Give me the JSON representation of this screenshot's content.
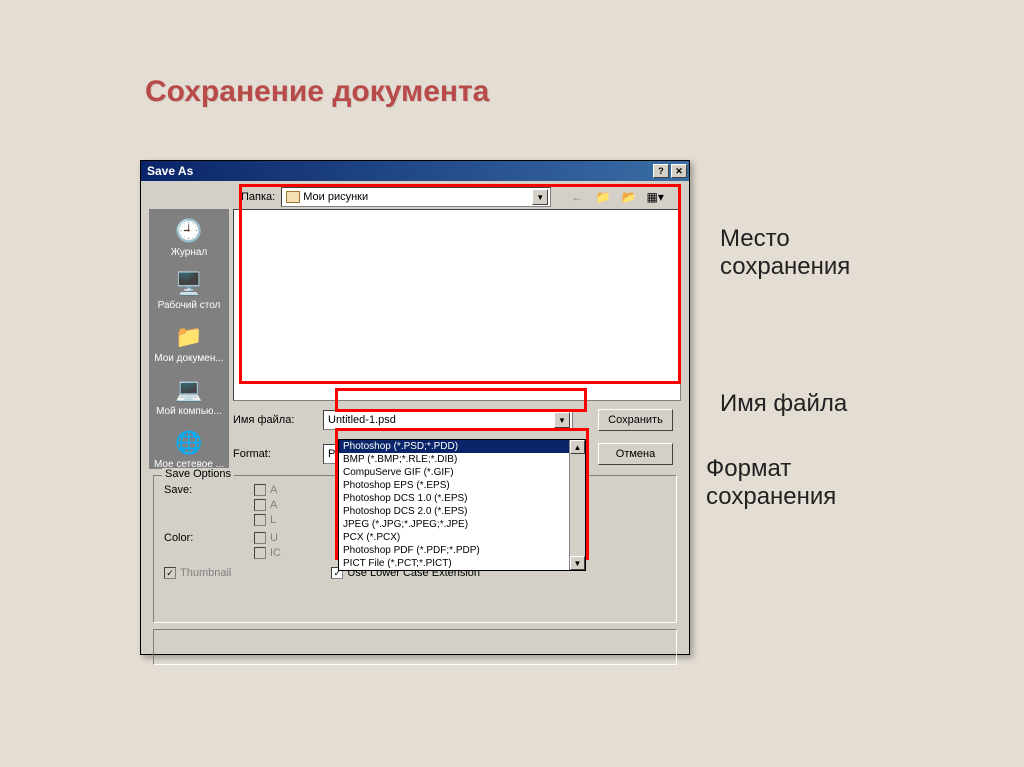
{
  "slide": {
    "title": "Сохранение документа"
  },
  "dialog": {
    "title": "Save As",
    "folder_label": "Папка:",
    "folder_value": "Мои рисунки",
    "places": [
      {
        "label": "Журнал"
      },
      {
        "label": "Рабочий стол"
      },
      {
        "label": "Мои докумен..."
      },
      {
        "label": "Мой компью..."
      },
      {
        "label": "Мое сетевое ..."
      }
    ],
    "name_label": "Имя файла:",
    "name_value": "Untitled-1.psd",
    "format_label": "Format:",
    "format_value": "Photoshop (*.PSD;*.PDD)",
    "format_options": [
      "Photoshop (*.PSD;*.PDD)",
      "BMP (*.BMP;*.RLE;*.DIB)",
      "CompuServe GIF (*.GIF)",
      "Photoshop EPS (*.EPS)",
      "Photoshop DCS 1.0 (*.EPS)",
      "Photoshop DCS 2.0 (*.EPS)",
      "JPEG (*.JPG;*.JPEG;*.JPE)",
      "PCX (*.PCX)",
      "Photoshop PDF (*.PDF;*.PDP)",
      "PICT File (*.PCT;*.PICT)"
    ],
    "save_btn": "Сохранить",
    "cancel_btn": "Отмена",
    "save_options_title": "Save Options",
    "save_label": "Save:",
    "color_label": "Color:",
    "thumbnail_label": "Thumbnail",
    "lowercase_label": "Use Lower Case Extension"
  },
  "annotations": {
    "location": "Место сохранения",
    "filename": "Имя файла",
    "format": "Формат сохранения"
  }
}
